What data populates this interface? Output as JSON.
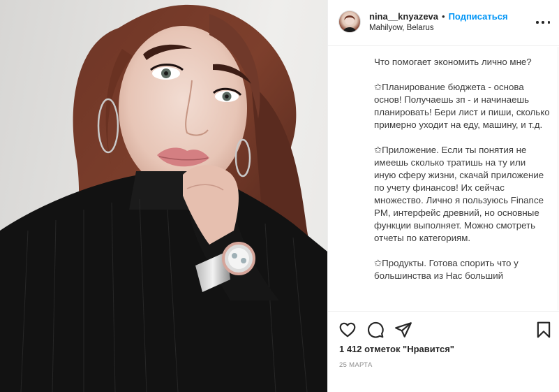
{
  "post": {
    "username": "nina__knyazeva",
    "separator": "•",
    "follow_label": "Подписаться",
    "location": "Mahilyow, Belarus",
    "caption": "Что помогает экономить лично мне?\n\n✩Планирование бюджета - основа основ! Получаешь зп - и начинаешь планировать! Бери лист и пиши, сколько примерно уходит на еду, машину, и т.д.\n\n✩Приложение. Если ты понятия не имеешь сколько тратишь на ту или иную сферу жизни, скачай приложение по учету финансов! Их сейчас множество. Лично я пользуюсь Finance PM, интерфейс древний, но основные функции выполняет. Можно смотреть отчеты по категориям.\n\n✩Продукты. Готова спорить что у большинства из Нас больший",
    "likes_text": "1 412 отметок \"Нравится\"",
    "date": "25 МАРТА"
  },
  "icons": {
    "more": "more-options-icon",
    "like": "heart-icon",
    "comment": "comment-icon",
    "share": "paper-plane-icon",
    "save": "bookmark-icon"
  },
  "colors": {
    "link": "#0095f6",
    "text": "#262626",
    "muted": "#8e8e8e",
    "border": "#efefef"
  }
}
